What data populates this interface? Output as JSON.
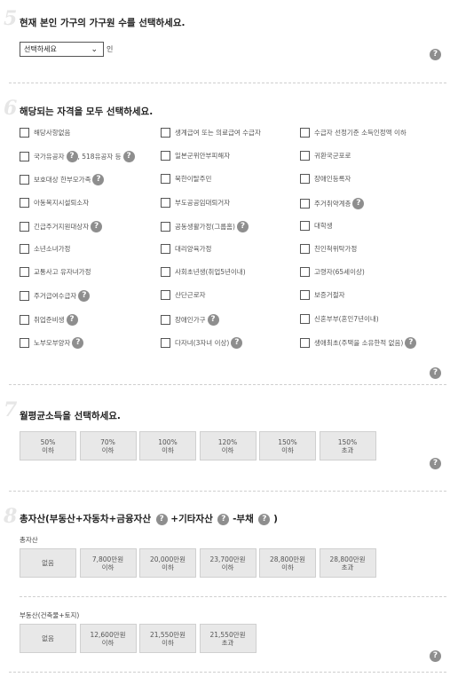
{
  "help_glyph": "?",
  "s5": {
    "num": "5",
    "title": "현재 본인 가구의 가구원 수를 선택하세요.",
    "select_value": "선택하세요",
    "chevron": "⌄",
    "unit": "인"
  },
  "s6": {
    "num": "6",
    "title": "해당되는 자격을 모두 선택하세요.",
    "options": [
      "해당사항없음",
      "생계급여 또는 의료급여 수급자",
      "수급자 선정기준 소득인정액 이하",
      "국가유공자",
      "일본군위안부피해자",
      "귀환국군포로",
      "보호대상 한부모가족",
      "북한이탈주민",
      "장애인등록자",
      "아동복지시설퇴소자",
      "부도공공임대퇴거자",
      "주거취약계층",
      "긴급주거지원대상자",
      "공동생활가정(그룹홈)",
      "대학생",
      "소년소녀가정",
      "대리양육가정",
      "친인척위탁가정",
      "교통사고 유자녀가정",
      "사회초년생(취업5년이내)",
      "고령자(65세이상)",
      "주거급여수급자",
      "산단근로자",
      "보증거절자",
      "취업준비생",
      "장애인가구",
      "신혼부부(혼인7년이내)",
      "노부모부양자",
      "다자녀(3자녀 이상)",
      "생애최초(주택을 소유한적 없음)"
    ],
    "extra_518": ", 518유공자 등"
  },
  "s7": {
    "num": "7",
    "title": "월평균소득을 선택하세요.",
    "options": [
      "50%\n이하",
      "70%\n이하",
      "100%\n이하",
      "120%\n이하",
      "150%\n이하",
      "150%\n초과"
    ]
  },
  "s8": {
    "num": "8",
    "title_a": "총자산(부동산+자동차+금융자산",
    "title_b": "+기타자산",
    "title_c": "-부채",
    "title_d": ")",
    "total_label": "총자산",
    "total_options": [
      "없음",
      "7,800만원\n이하",
      "20,000만원\n이하",
      "23,700만원\n이하",
      "28,800만원\n이하",
      "28,800만원\n초과"
    ],
    "re_label": "부동산(건축물+토지)",
    "re_options": [
      "없음",
      "12,600만원\n이하",
      "21,550만원\n이하",
      "21,550만원\n초과"
    ]
  }
}
